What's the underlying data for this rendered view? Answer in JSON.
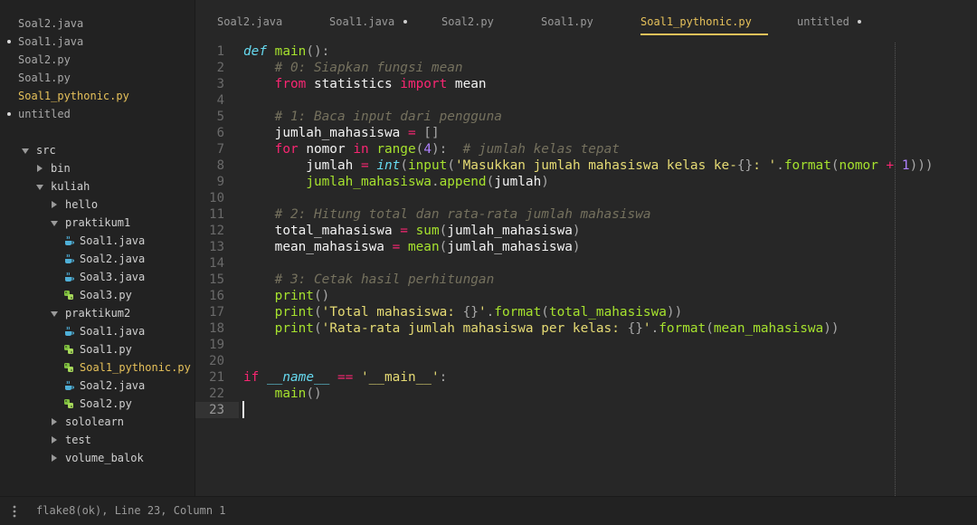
{
  "sidebar": {
    "open_files": [
      {
        "label": "Soal2.java",
        "dirty": false,
        "active": false
      },
      {
        "label": "Soal1.java",
        "dirty": true,
        "active": false
      },
      {
        "label": "Soal2.py",
        "dirty": false,
        "active": false
      },
      {
        "label": "Soal1.py",
        "dirty": false,
        "active": false
      },
      {
        "label": "Soal1_pythonic.py",
        "dirty": false,
        "active": true
      },
      {
        "label": "untitled",
        "dirty": true,
        "active": false
      }
    ],
    "tree": [
      {
        "label": "src",
        "type": "folder",
        "expanded": true
      },
      {
        "label": "bin",
        "type": "folder",
        "expanded": false
      },
      {
        "label": "kuliah",
        "type": "folder",
        "expanded": true
      },
      {
        "label": "hello",
        "type": "folder",
        "expanded": false
      },
      {
        "label": "praktikum1",
        "type": "folder",
        "expanded": true
      },
      {
        "label": "Soal1.java",
        "type": "java"
      },
      {
        "label": "Soal2.java",
        "type": "java"
      },
      {
        "label": "Soal3.java",
        "type": "java"
      },
      {
        "label": "Soal3.py",
        "type": "py"
      },
      {
        "label": "praktikum2",
        "type": "folder",
        "expanded": true
      },
      {
        "label": "Soal1.java",
        "type": "java"
      },
      {
        "label": "Soal1.py",
        "type": "py"
      },
      {
        "label": "Soal1_pythonic.py",
        "type": "py",
        "active": true
      },
      {
        "label": "Soal2.java",
        "type": "java"
      },
      {
        "label": "Soal2.py",
        "type": "py"
      },
      {
        "label": "sololearn",
        "type": "folder",
        "expanded": false
      },
      {
        "label": "test",
        "type": "folder",
        "expanded": false
      },
      {
        "label": "volume_balok",
        "type": "folder",
        "expanded": false
      }
    ]
  },
  "tabs": [
    {
      "label": "Soal2.java",
      "dirty": false,
      "active": false
    },
    {
      "label": "Soal1.java",
      "dirty": true,
      "active": false
    },
    {
      "label": "Soal2.py",
      "dirty": false,
      "active": false
    },
    {
      "label": "Soal1.py",
      "dirty": false,
      "active": false
    },
    {
      "label": "Soal1_pythonic.py",
      "dirty": false,
      "active": true
    },
    {
      "label": "untitled",
      "dirty": true,
      "active": false
    }
  ],
  "editor": {
    "current_line": 23,
    "lines": [
      [
        [
          "def",
          "def "
        ],
        [
          "fn",
          "main"
        ],
        [
          "punct",
          "():"
        ]
      ],
      [
        [
          "cm",
          "    # 0: Siapkan fungsi mean"
        ]
      ],
      [
        [
          "",
          "    "
        ],
        [
          "kw",
          "from"
        ],
        [
          "",
          " statistics "
        ],
        [
          "kw",
          "import"
        ],
        [
          "",
          " mean"
        ]
      ],
      [],
      [
        [
          "cm",
          "    # 1: Baca input dari pengguna"
        ]
      ],
      [
        [
          "",
          "    jumlah_mahasiswa "
        ],
        [
          "kw",
          "="
        ],
        [
          "punct",
          " []"
        ]
      ],
      [
        [
          "",
          "    "
        ],
        [
          "kw",
          "for"
        ],
        [
          "",
          " nomor "
        ],
        [
          "kw",
          "in"
        ],
        [
          "",
          " "
        ],
        [
          "bi",
          "range"
        ],
        [
          "punct",
          "("
        ],
        [
          "num",
          "4"
        ],
        [
          "punct",
          "):"
        ],
        [
          "",
          "  "
        ],
        [
          "cm",
          "# jumlah kelas tepat"
        ]
      ],
      [
        [
          "",
          "        jumlah "
        ],
        [
          "kw",
          "="
        ],
        [
          "",
          " "
        ],
        [
          "def",
          "int"
        ],
        [
          "punct",
          "("
        ],
        [
          "bi",
          "input"
        ],
        [
          "punct",
          "("
        ],
        [
          "str",
          "'Masukkan jumlah mahasiswa kelas ke-"
        ],
        [
          "punct",
          "{}"
        ],
        [
          "str",
          ": '"
        ],
        [
          "punct",
          "."
        ],
        [
          "fn",
          "format"
        ],
        [
          "punct",
          "("
        ],
        [
          "fn",
          "nomor"
        ],
        [
          "",
          " "
        ],
        [
          "kw",
          "+"
        ],
        [
          "",
          " "
        ],
        [
          "num",
          "1"
        ],
        [
          "punct",
          ")))"
        ]
      ],
      [
        [
          "",
          "        "
        ],
        [
          "fn",
          "jumlah_mahasiswa"
        ],
        [
          "punct",
          "."
        ],
        [
          "fn",
          "append"
        ],
        [
          "punct",
          "("
        ],
        [
          "",
          "jumlah"
        ],
        [
          "punct",
          ")"
        ]
      ],
      [],
      [
        [
          "cm",
          "    # 2: Hitung total dan rata-rata jumlah mahasiswa"
        ]
      ],
      [
        [
          "",
          "    total_mahasiswa "
        ],
        [
          "kw",
          "="
        ],
        [
          "",
          " "
        ],
        [
          "bi",
          "sum"
        ],
        [
          "punct",
          "("
        ],
        [
          "",
          "jumlah_mahasiswa"
        ],
        [
          "punct",
          ")"
        ]
      ],
      [
        [
          "",
          "    mean_mahasiswa "
        ],
        [
          "kw",
          "="
        ],
        [
          "",
          " "
        ],
        [
          "fn",
          "mean"
        ],
        [
          "punct",
          "("
        ],
        [
          "",
          "jumlah_mahasiswa"
        ],
        [
          "punct",
          ")"
        ]
      ],
      [],
      [
        [
          "cm",
          "    # 3: Cetak hasil perhitungan"
        ]
      ],
      [
        [
          "",
          "    "
        ],
        [
          "bi",
          "print"
        ],
        [
          "punct",
          "()"
        ]
      ],
      [
        [
          "",
          "    "
        ],
        [
          "bi",
          "print"
        ],
        [
          "punct",
          "("
        ],
        [
          "str",
          "'Total mahasiswa: "
        ],
        [
          "punct",
          "{}"
        ],
        [
          "str",
          "'"
        ],
        [
          "punct",
          "."
        ],
        [
          "fn",
          "format"
        ],
        [
          "punct",
          "("
        ],
        [
          "fn",
          "total_mahasiswa"
        ],
        [
          "punct",
          "))"
        ]
      ],
      [
        [
          "",
          "    "
        ],
        [
          "bi",
          "print"
        ],
        [
          "punct",
          "("
        ],
        [
          "str",
          "'Rata-rata jumlah mahasiswa per kelas: "
        ],
        [
          "punct",
          "{}"
        ],
        [
          "str",
          "'"
        ],
        [
          "punct",
          "."
        ],
        [
          "fn",
          "format"
        ],
        [
          "punct",
          "("
        ],
        [
          "fn",
          "mean_mahasiswa"
        ],
        [
          "punct",
          "))"
        ]
      ],
      [],
      [],
      [
        [
          "kw",
          "if"
        ],
        [
          "",
          " "
        ],
        [
          "def",
          "__name__"
        ],
        [
          "",
          " "
        ],
        [
          "kw",
          "=="
        ],
        [
          "",
          " "
        ],
        [
          "str",
          "'__main__'"
        ],
        [
          "punct",
          ":"
        ]
      ],
      [
        [
          "",
          "    "
        ],
        [
          "fn",
          "main"
        ],
        [
          "punct",
          "()"
        ]
      ],
      []
    ]
  },
  "statusbar": {
    "text": "flake8(ok), Line 23, Column 1"
  },
  "colors": {
    "accent": "#e6c15a",
    "background": "#272727",
    "sidebar": "#222222"
  }
}
